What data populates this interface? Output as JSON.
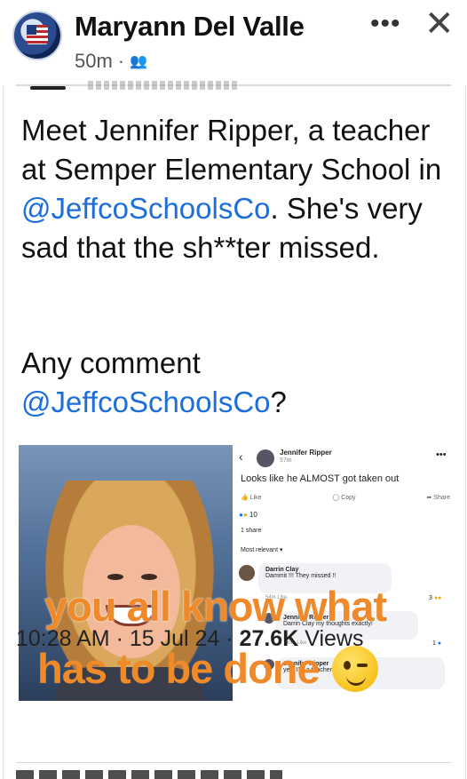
{
  "header": {
    "poster_name": "Maryann Del Valle",
    "time_ago": "50m",
    "audience_icon": "friends-icon",
    "more_label": "•••",
    "close_label": "✕"
  },
  "tweet": {
    "text_part1": "Meet Jennifer Ripper, a teacher at Semper Elementary School in ",
    "mention1": "@JeffcoSchoolsCo",
    "text_part2": ". She's very sad that the sh**ter missed.",
    "comment_prefix": "Any comment",
    "mention2": "@JeffcoSchoolsCo",
    "comment_suffix": "?",
    "timestamp_time": "10:28 AM",
    "timestamp_date": "15 Jul 24",
    "views_count": "27.6K",
    "views_label": "Views"
  },
  "embedded_fb": {
    "name": "Jennifer Ripper",
    "time": "57m ·",
    "post_text": "Looks like he ALMOST got taken out",
    "actions": [
      "Like",
      "Copy",
      "Share"
    ],
    "reactions_count": "10",
    "shares": "1 share",
    "sort_label": "Most relevant",
    "comments": [
      {
        "name": "Darrin Clay",
        "text": "Dammit !!! They missed !!",
        "meta": "54m   Like",
        "reacts": "3"
      },
      {
        "name": "Jennifer Ripper",
        "text": "Darrin Clay my thoughts exactly!",
        "meta": "50m   Like",
        "reacts": "1"
      },
      {
        "name": "Jennifer Ripper",
        "text": "yes, I'm a teacher, I think for"
      }
    ]
  },
  "overlay": {
    "line1": "you all know what",
    "line2": "has to be done",
    "emoji": "winking-face"
  }
}
